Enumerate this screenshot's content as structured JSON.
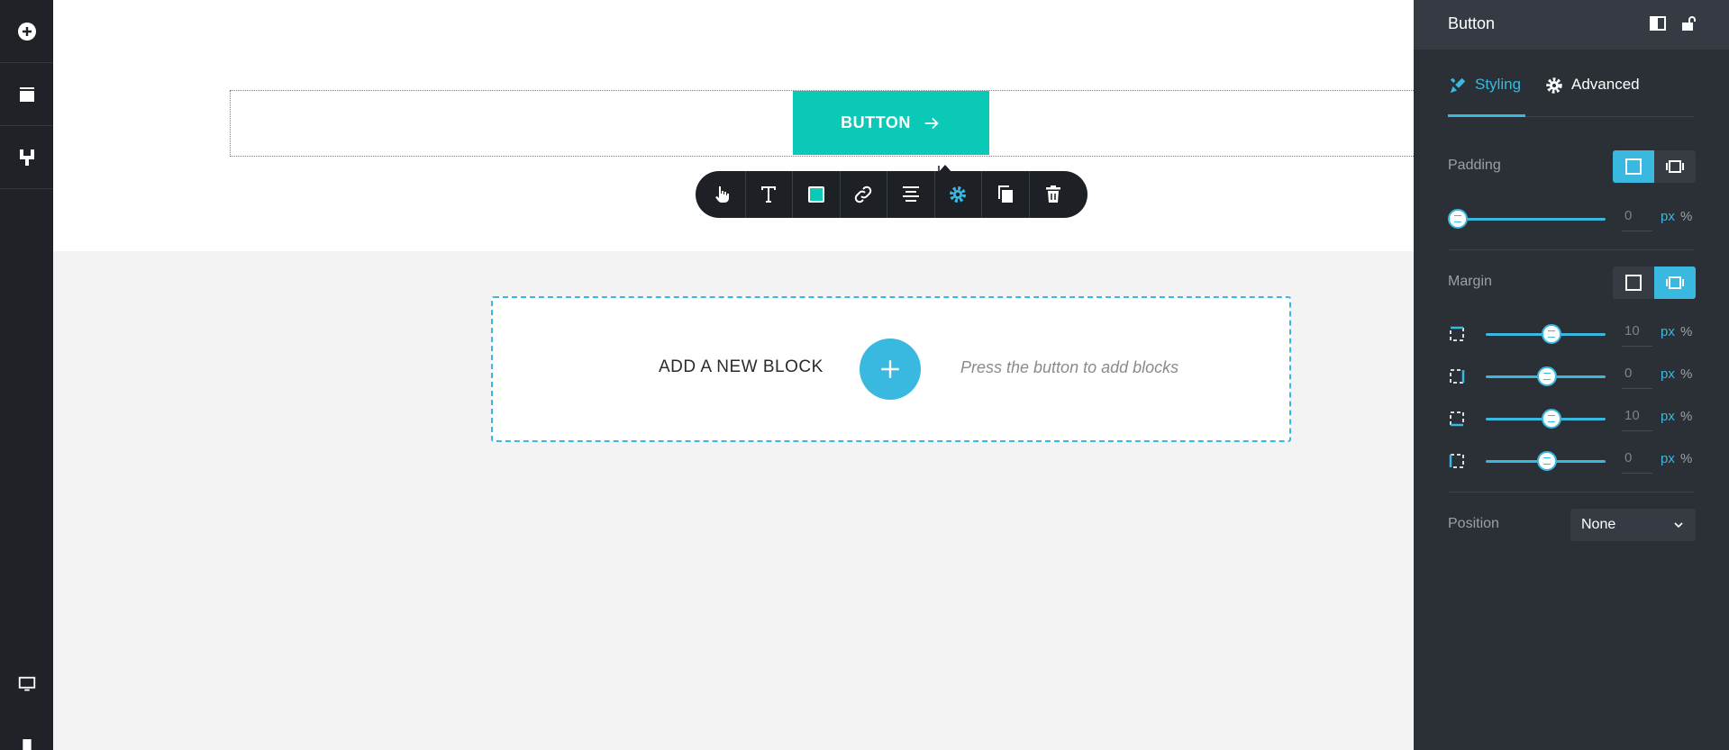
{
  "sidebar": {
    "icons": [
      "add-icon",
      "layers-icon",
      "paint-roller-icon",
      "desktop-icon",
      "mobile-icon"
    ]
  },
  "canvas": {
    "button_label": "BUTTON",
    "button_color": "#0ac9b7",
    "add_block": {
      "title": "ADD A NEW BLOCK",
      "hint": "Press the button to add blocks"
    }
  },
  "toolbar": {
    "items": [
      "hand-pointer-icon",
      "text-icon",
      "color-swatch-icon",
      "link-icon",
      "align-center-icon",
      "gear-icon",
      "duplicate-icon",
      "trash-icon"
    ],
    "swatch_color": "#0ac9b7",
    "active_item": "gear-icon"
  },
  "panel": {
    "title": "Button",
    "tabs": {
      "styling": "Styling",
      "advanced": "Advanced"
    },
    "padding": {
      "label": "Padding",
      "value": "0",
      "unit_px": "px",
      "unit_pct": "%"
    },
    "margin": {
      "label": "Margin",
      "rows": [
        {
          "side": "top",
          "value": "10",
          "unit_px": "px",
          "unit_pct": "%"
        },
        {
          "side": "right",
          "value": "0",
          "unit_px": "px",
          "unit_pct": "%"
        },
        {
          "side": "bottom",
          "value": "10",
          "unit_px": "px",
          "unit_pct": "%"
        },
        {
          "side": "left",
          "value": "0",
          "unit_px": "px",
          "unit_pct": "%"
        }
      ]
    },
    "position": {
      "label": "Position",
      "value": "None"
    }
  },
  "colors": {
    "accent": "#3ab9e0",
    "panel_bg": "#2b2f36",
    "sidebar_bg": "#1f2227"
  }
}
